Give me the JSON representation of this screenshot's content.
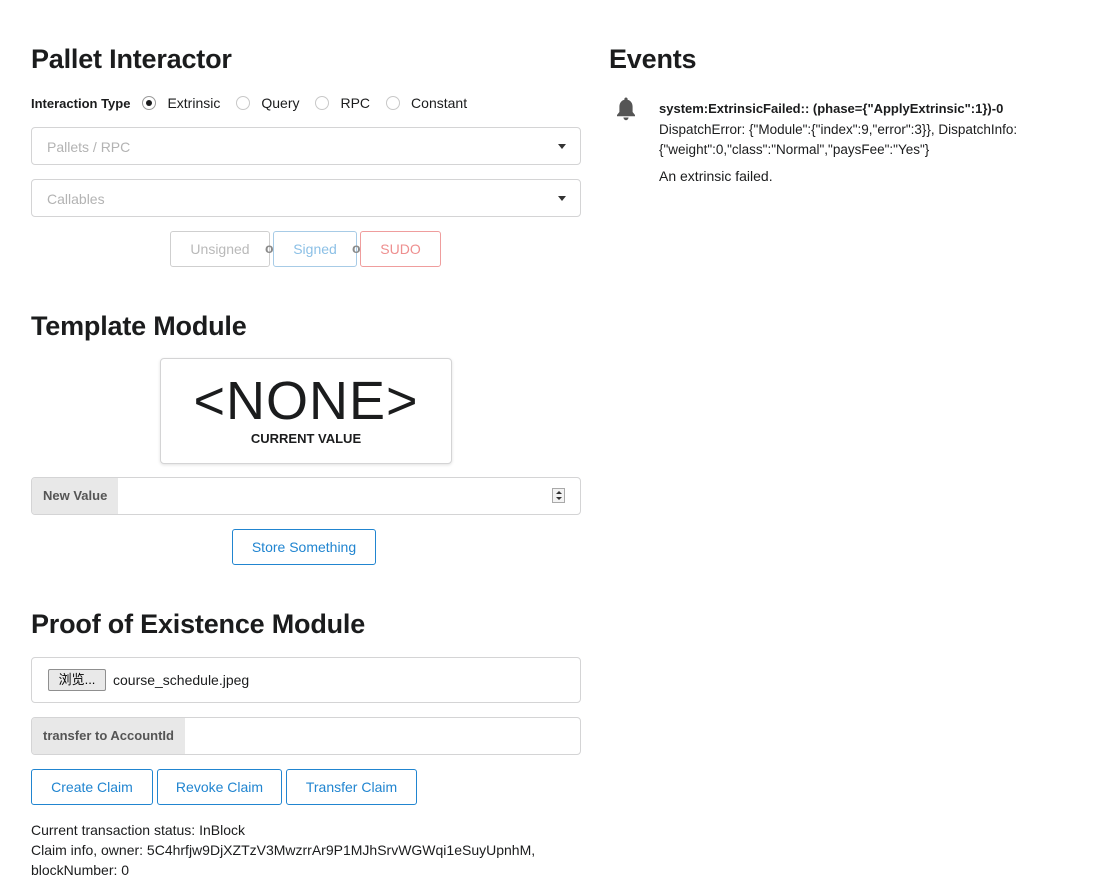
{
  "pallet_interactor": {
    "title": "Pallet Interactor",
    "interaction_type_label": "Interaction Type",
    "options": [
      "Extrinsic",
      "Query",
      "RPC",
      "Constant"
    ],
    "selected": "Extrinsic",
    "pallets_placeholder": "Pallets / RPC",
    "callables_placeholder": "Callables",
    "unsigned_label": "Unsigned",
    "or_label": "or",
    "signed_label": "Signed",
    "sudo_label": "SUDO"
  },
  "template_module": {
    "title": "Template Module",
    "current_value": "<NONE>",
    "current_value_caption": "CURRENT VALUE",
    "new_value_label": "New Value",
    "new_value": "",
    "store_button": "Store Something"
  },
  "poe_module": {
    "title": "Proof of Existence Module",
    "browse_button": "浏览...",
    "file_name": "course_schedule.jpeg",
    "transfer_label": "transfer to AccountId",
    "transfer_value": "",
    "create_claim": "Create Claim",
    "revoke_claim": "Revoke Claim",
    "transfer_claim": "Transfer Claim",
    "status_line": "Current transaction status: InBlock",
    "claim_info_line1": "Claim info, owner: 5C4hrfjw9DjXZTzV3MwzrrAr9P1MJhSrvWGWqi1eSuyUpnhM,",
    "claim_info_line2": "blockNumber: 0"
  },
  "events": {
    "title": "Events",
    "items": [
      {
        "icon": "bell-icon",
        "title": "system:ExtrinsicFailed:: (phase={\"ApplyExtrinsic\":1})-0",
        "description": "DispatchError: {\"Module\":{\"index\":9,\"error\":3}}, DispatchInfo: {\"weight\":0,\"class\":\"Normal\",\"paysFee\":\"Yes\"}",
        "message": "An extrinsic failed."
      }
    ]
  },
  "colors": {
    "primary_blue": "#2185d0",
    "sudo_red": "#ee8f8f",
    "label_grey_bg": "#e8e8e8"
  }
}
